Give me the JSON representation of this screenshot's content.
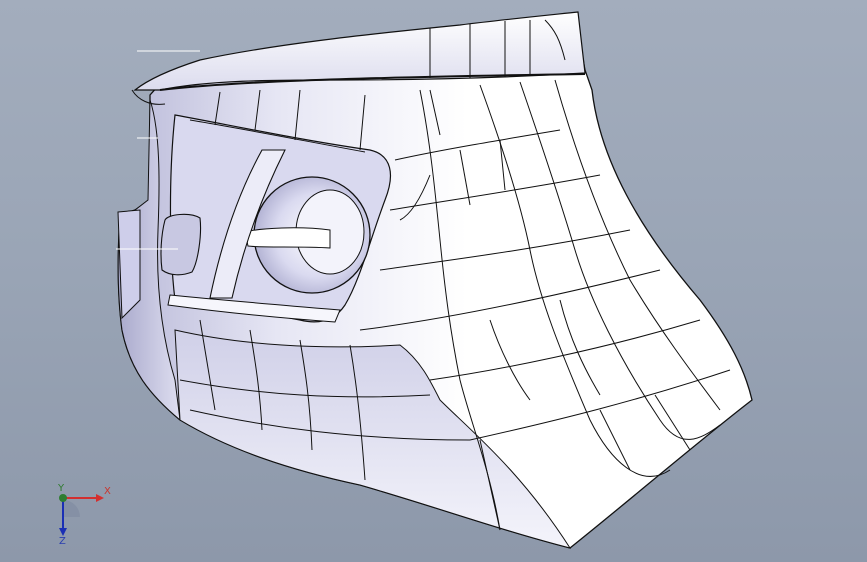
{
  "viewport": {
    "background_top": "#a3adbd",
    "background_bottom": "#8d98aa",
    "model_fill_light": "#ffffff",
    "model_fill_shade": "#c9c9e2",
    "edge_color": "#111111"
  },
  "triad": {
    "x_label": "X",
    "y_label": "Y",
    "z_label": "Z",
    "x_color": "#d32f2f",
    "y_color": "#2e7d32",
    "z_color": "#1a2fb5"
  }
}
